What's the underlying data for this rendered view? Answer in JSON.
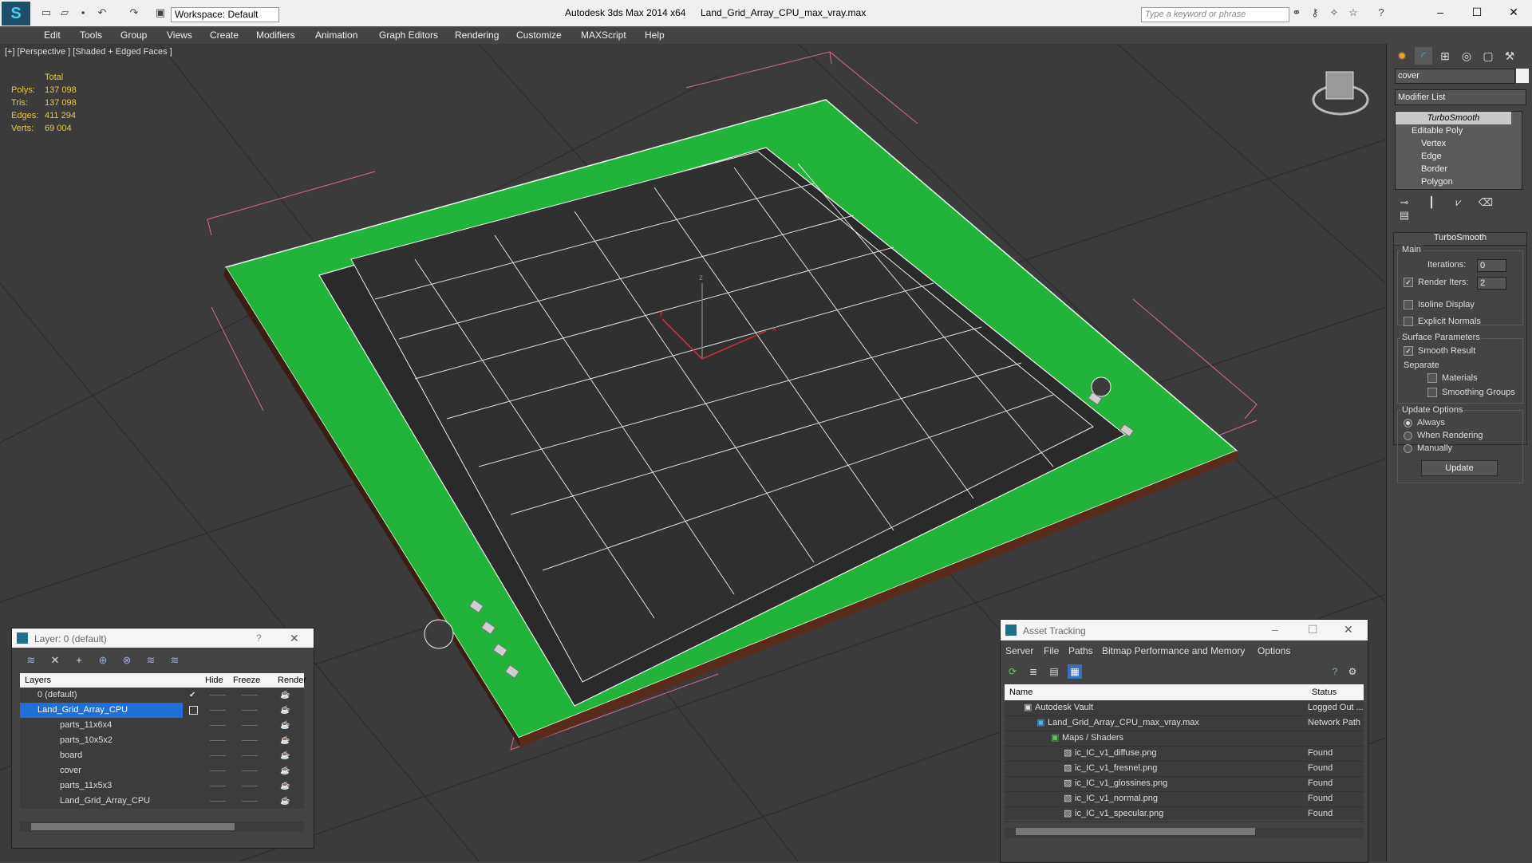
{
  "window": {
    "app_title": "Autodesk 3ds Max  2014 x64",
    "file_title": "Land_Grid_Array_CPU_max_vray.max",
    "workspace": "Workspace: Default",
    "search_placeholder": "Type a keyword or phrase"
  },
  "menu": [
    "Edit",
    "Tools",
    "Group",
    "Views",
    "Create",
    "Modifiers",
    "Animation",
    "Graph Editors",
    "Rendering",
    "Customize",
    "MAXScript",
    "Help"
  ],
  "viewport": {
    "label": "[+] [Perspective ] [Shaded + Edged Faces ]",
    "stats": {
      "header": "Total",
      "rows": [
        {
          "label": "Polys:",
          "value": "137 098"
        },
        {
          "label": "Tris:",
          "value": "137 098"
        },
        {
          "label": "Edges:",
          "value": "411 294"
        },
        {
          "label": "Verts:",
          "value": "69 004"
        }
      ]
    }
  },
  "command_panel": {
    "object_name": "cover",
    "modifier_list": "Modifier List",
    "stack": [
      "TurboSmooth",
      "Editable Poly",
      "Vertex",
      "Edge",
      "Border",
      "Polygon"
    ],
    "rollout_title": "TurboSmooth",
    "main_label": "Main",
    "iterations_label": "Iterations:",
    "iterations_value": "0",
    "render_iters_label": "Render Iters:",
    "render_iters_value": "2",
    "isoline_label": "Isoline Display",
    "explicit_normals_label": "Explicit Normals",
    "surface_params_label": "Surface Parameters",
    "smooth_result_label": "Smooth Result",
    "separate_label": "Separate",
    "materials_label": "Materials",
    "smoothing_groups_label": "Smoothing Groups",
    "update_options_label": "Update Options",
    "always_label": "Always",
    "when_rendering_label": "When Rendering",
    "manually_label": "Manually",
    "update_button": "Update"
  },
  "layer_dialog": {
    "title": "Layer: 0 (default)",
    "help": "?",
    "columns": [
      "Layers",
      "Hide",
      "Freeze",
      "Render"
    ],
    "rows": [
      {
        "name": "0 (default)"
      },
      {
        "name": "Land_Grid_Array_CPU"
      },
      {
        "name": "parts_11x6x4"
      },
      {
        "name": "parts_10x5x2"
      },
      {
        "name": "board"
      },
      {
        "name": "cover"
      },
      {
        "name": "parts_11x5x3"
      },
      {
        "name": "Land_Grid_Array_CPU"
      }
    ]
  },
  "asset_dialog": {
    "title": "Asset Tracking",
    "menu": [
      "Server",
      "File",
      "Paths",
      "Bitmap Performance and Memory",
      "Options"
    ],
    "columns": [
      "Name",
      "Status"
    ],
    "rows": [
      {
        "name": "Autodesk Vault",
        "status": "Logged Out ..."
      },
      {
        "name": "Land_Grid_Array_CPU_max_vray.max",
        "status": "Network Path"
      },
      {
        "name": "Maps / Shaders",
        "status": ""
      },
      {
        "name": "ic_IC_v1_diffuse.png",
        "status": "Found"
      },
      {
        "name": "ic_IC_v1_fresnel.png",
        "status": "Found"
      },
      {
        "name": "ic_IC_v1_glossines.png",
        "status": "Found"
      },
      {
        "name": "ic_IC_v1_normal.png",
        "status": "Found"
      },
      {
        "name": "ic_IC_v1_specular.png",
        "status": "Found"
      }
    ]
  },
  "colors": {
    "board_green": "#22b43a",
    "stats_yellow": "#e8c84a",
    "selection_blue": "#1f6fd6",
    "viewport_bg": "#3b3b3b"
  }
}
